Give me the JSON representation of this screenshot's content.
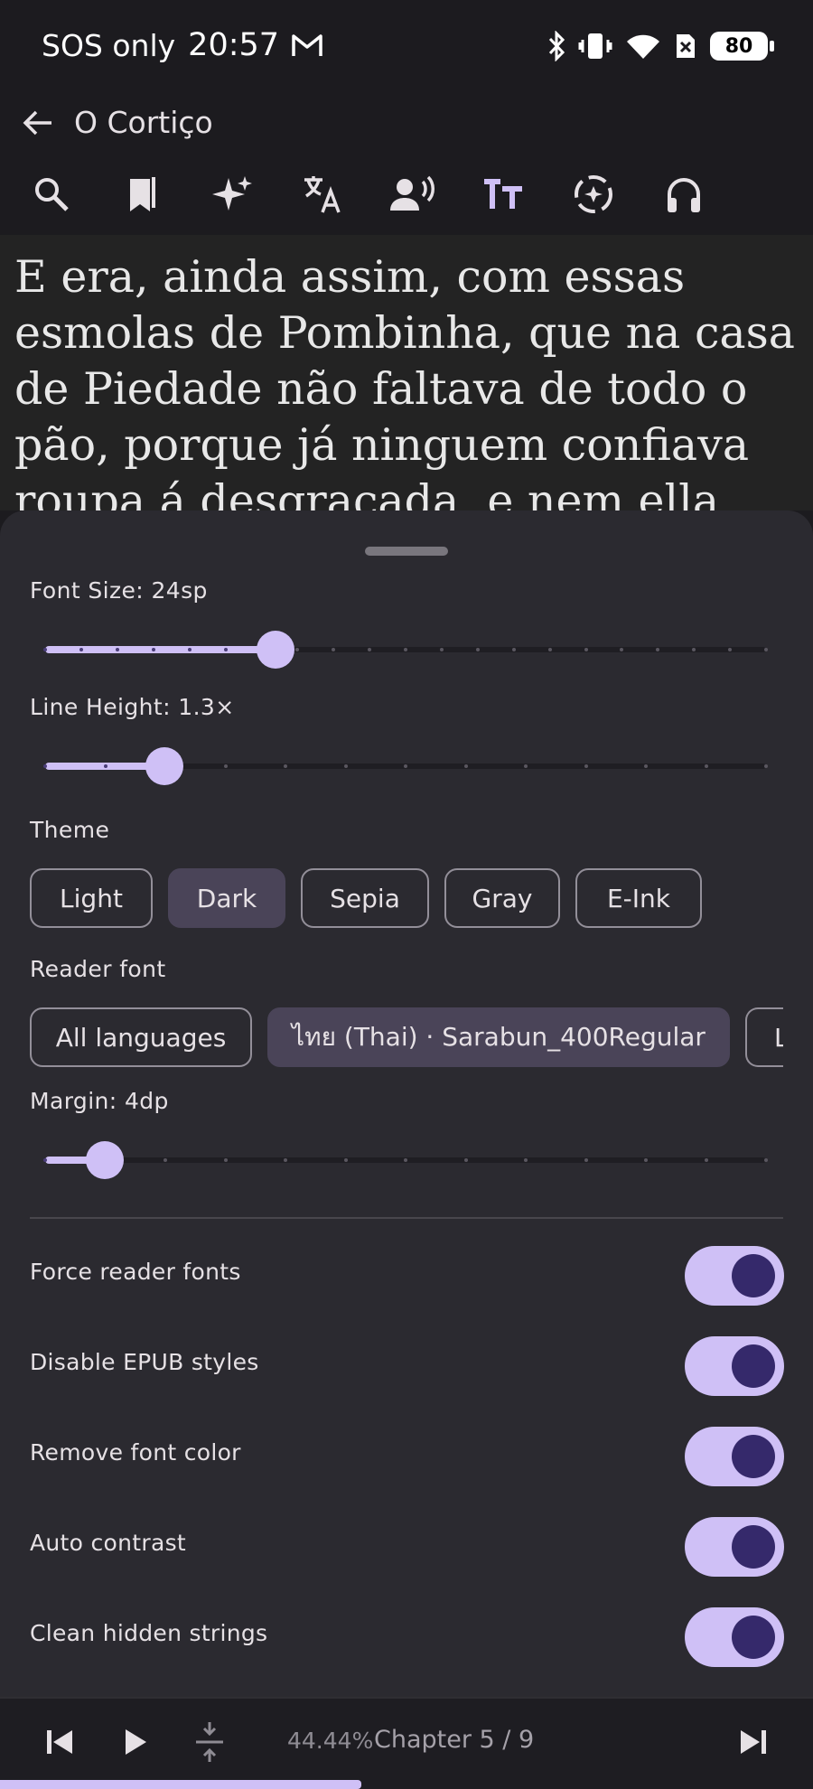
{
  "status_bar": {
    "carrier": "SOS only",
    "time": "20:57",
    "battery": "80"
  },
  "app_bar": {
    "title": "O Cortiço"
  },
  "toolbar": {
    "icons": [
      "search-icon",
      "bookmarks-icon",
      "ai-sparkle-icon",
      "translate-icon",
      "read-aloud-icon",
      "text-format-icon",
      "sync-icon",
      "headphones-icon"
    ],
    "active_icon": "text-format-icon"
  },
  "reader": {
    "text": "E era, ainda assim, com essas esmolas de Pombinha, que na casa de Piedade não faltava de todo o pão, porque já ninguem confiava roupa á desgraçada, e nem ella"
  },
  "settings": {
    "font_size_label": "Font Size: 24sp",
    "font_size_value": 0.32,
    "line_height_label": "Line Height: 1.3×",
    "line_height_value": 0.166,
    "theme_label": "Theme",
    "themes": [
      "Light",
      "Dark",
      "Sepia",
      "Gray",
      "E-Ink"
    ],
    "selected_theme": "Dark",
    "reader_font_label": "Reader font",
    "font_chips": [
      "All languages",
      "ไทย (Thai) · Sarabun_400Regular",
      "L"
    ],
    "margin_label": "Margin: 4dp",
    "margin_value": 0.083,
    "toggles": [
      {
        "label": "Force reader fonts",
        "on": true
      },
      {
        "label": "Disable EPUB styles",
        "on": true
      },
      {
        "label": "Remove font color",
        "on": true
      },
      {
        "label": "Auto contrast",
        "on": true
      },
      {
        "label": "Clean hidden strings",
        "on": true
      }
    ]
  },
  "bottom_bar": {
    "percent": "44.44%",
    "chapter": "Chapter 5 / 9",
    "progress": 0.4444
  },
  "colors": {
    "accent": "#cfc0f6",
    "sheet": "#2b2a30",
    "background": "#1c1b1f"
  }
}
